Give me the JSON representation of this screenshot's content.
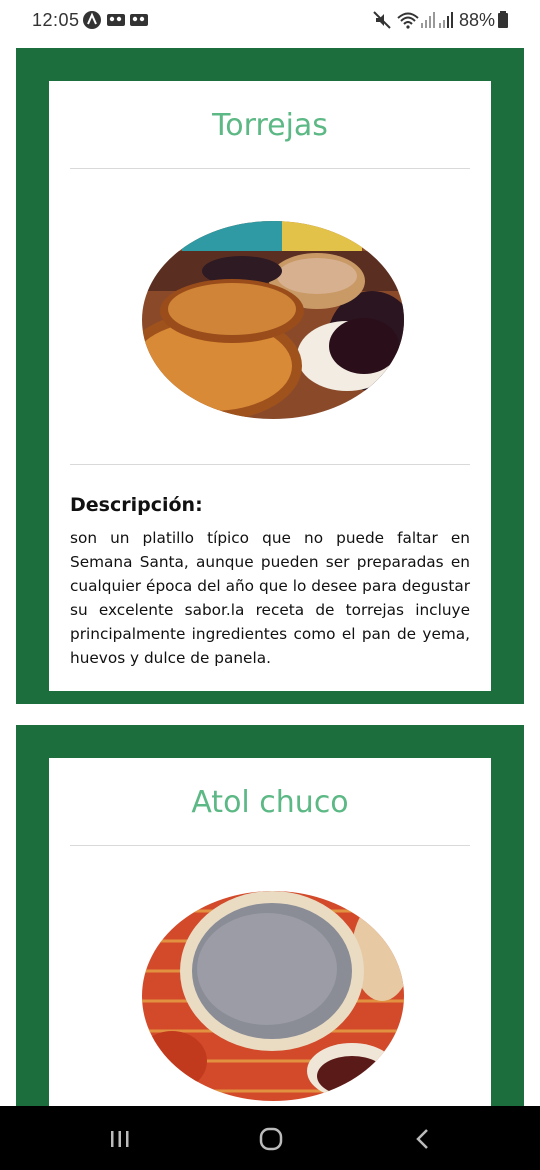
{
  "status_bar": {
    "time": "12:05",
    "battery": "88%"
  },
  "recipes": [
    {
      "title": "Torrejas",
      "description_heading": "Descripción:",
      "description": "son un platillo típico que no puede faltar en Semana Santa, aunque pueden ser preparadas en cualquier época del año que lo desee para degustar su excelente sabor.la receta de torrejas incluye principalmente ingredientes como el pan de yema, huevos y dulce de panela."
    },
    {
      "title": "Atol chuco"
    }
  ],
  "colors": {
    "card_frame": "#1c6e3d",
    "title_green": "#5cb884",
    "nav_bar": "#000000"
  }
}
